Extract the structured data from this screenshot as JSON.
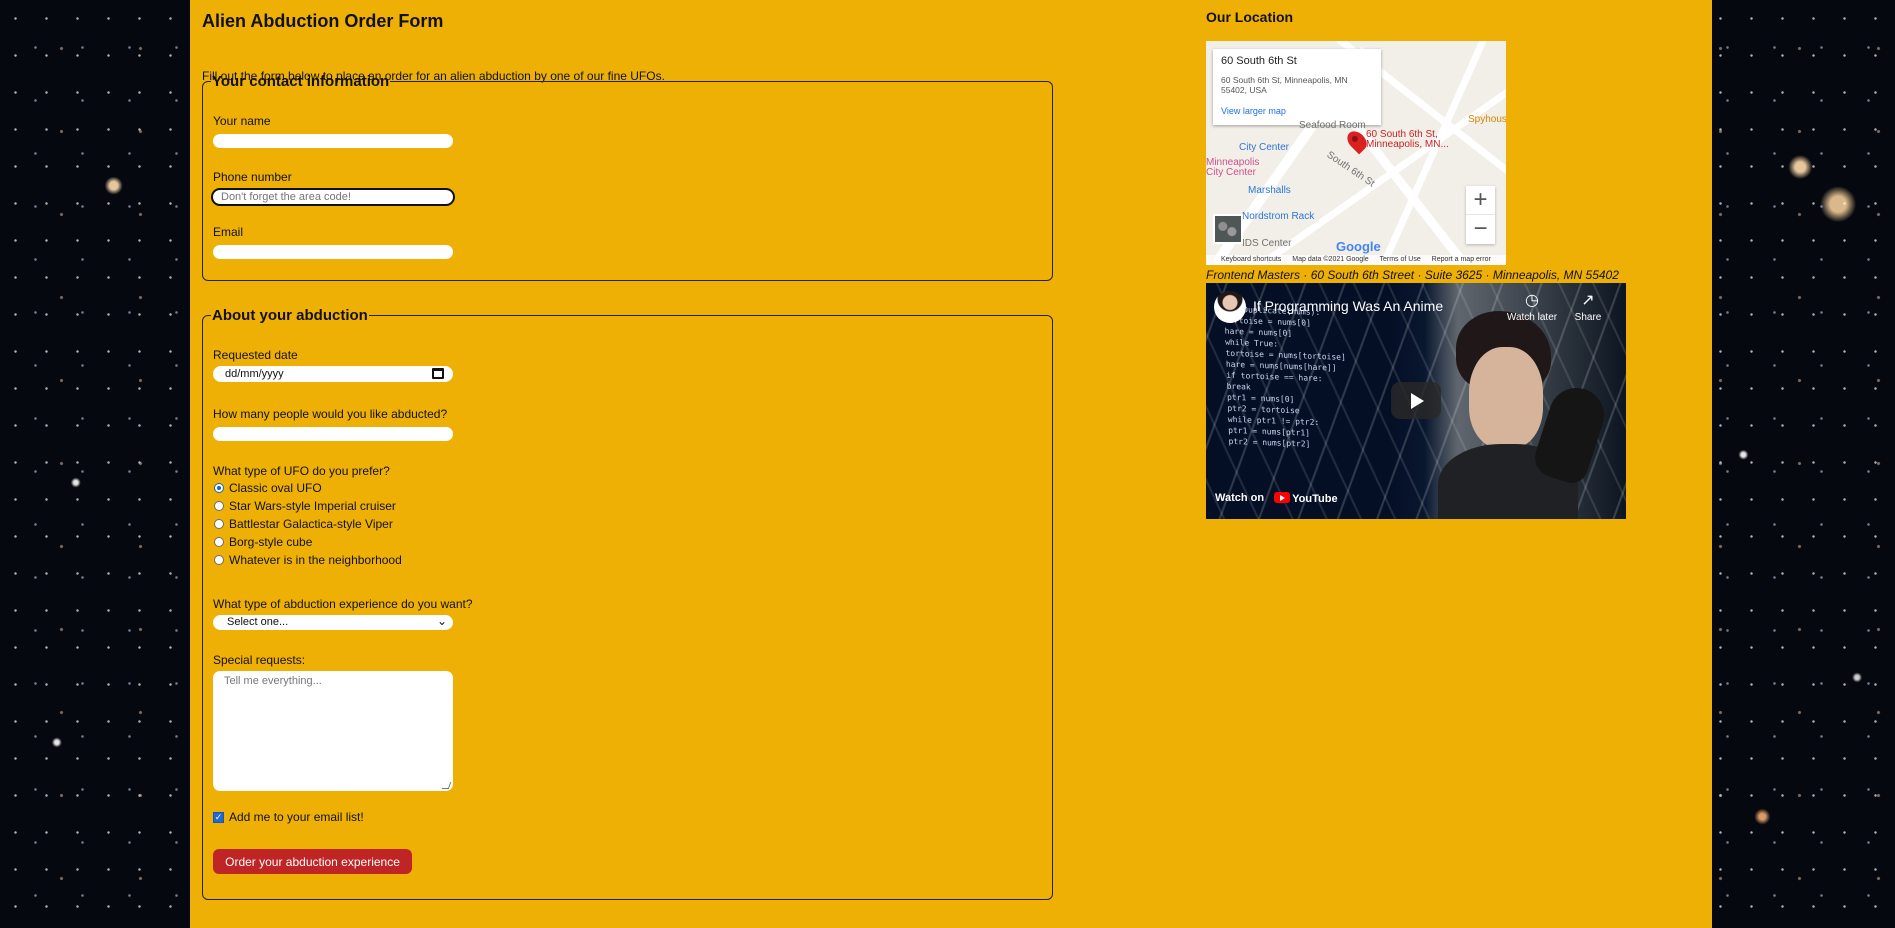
{
  "page": {
    "title": "Alien Abduction Order Form",
    "intro": "Fill out the form below to place an order for an alien abduction by one of our fine UFOs."
  },
  "contact": {
    "legend": "Your contact information",
    "name_label": "Your name",
    "name_value": "",
    "phone_label": "Phone number",
    "phone_placeholder": "Don't forget the area code!",
    "email_label": "Email",
    "email_value": ""
  },
  "abduction": {
    "legend": "About your abduction",
    "date_label": "Requested date",
    "date_placeholder": "dd/mm/yyyy",
    "people_label": "How many people would you like abducted?",
    "people_value": "",
    "ufo_label": "What type of UFO do you prefer?",
    "ufo_options": [
      "Classic oval UFO",
      "Star Wars-style Imperial cruiser",
      "Battlestar Galactica-style Viper",
      "Borg-style cube",
      "Whatever is in the neighborhood"
    ],
    "selected_ufo": "Classic oval UFO",
    "experience_label": "What type of abduction experience do you want?",
    "experience_selected": "Select one...",
    "requests_label": "Special requests:",
    "requests_placeholder": "Tell me everything...",
    "email_list_label": "Add me to your email list!",
    "email_list_checked": true,
    "submit_label": "Order your abduction experience"
  },
  "location": {
    "title": "Our Location",
    "map": {
      "place_name": "60 South 6th St",
      "address_line_1": "60 South 6th St, Minneapolis, MN",
      "address_line_2": "55402, USA",
      "larger_map_link": "View larger map",
      "pin_label_line_1": "60 South 6th St,",
      "pin_label_line_2": "Minneapolis, MN...",
      "street_label": "South 6th St",
      "places": [
        "City Center",
        "Marshalls",
        "Nordstrom Rack",
        "Seafood Room",
        "Spyhouse",
        "IDS Center",
        "Minneapolis City Center"
      ],
      "footer": [
        "Keyboard shortcuts",
        "Map data ©2021 Google",
        "Terms of Use",
        "Report a map error"
      ],
      "zoom_in": "+",
      "zoom_out": "−",
      "logo": "Google"
    },
    "address": "Frontend Masters · 60 South 6th Street · Suite 3625 · Minneapolis, MN 55402"
  },
  "video": {
    "title": "If Programming Was An Anime",
    "watch_later": "Watch later",
    "share": "Share",
    "watch_on": "Watch on",
    "youtube": "YouTube",
    "code_lines": [
      "findDuplicate(nums):",
      "tortoise = nums[0]",
      "hare = nums[0]",
      "while True:",
      "  tortoise = nums[tortoise]",
      "  hare = nums[nums[hare]]",
      "  if tortoise == hare:",
      "    break",
      "",
      "ptr1 = nums[0]",
      "ptr2 = tortoise",
      "while ptr1 != ptr2:",
      "  ptr1 = nums[ptr1]",
      "  ptr2 = nums[ptr2]"
    ]
  },
  "colors": {
    "panel": "#efb006",
    "button": "#bf2525",
    "accent_blue": "#2468d4"
  }
}
